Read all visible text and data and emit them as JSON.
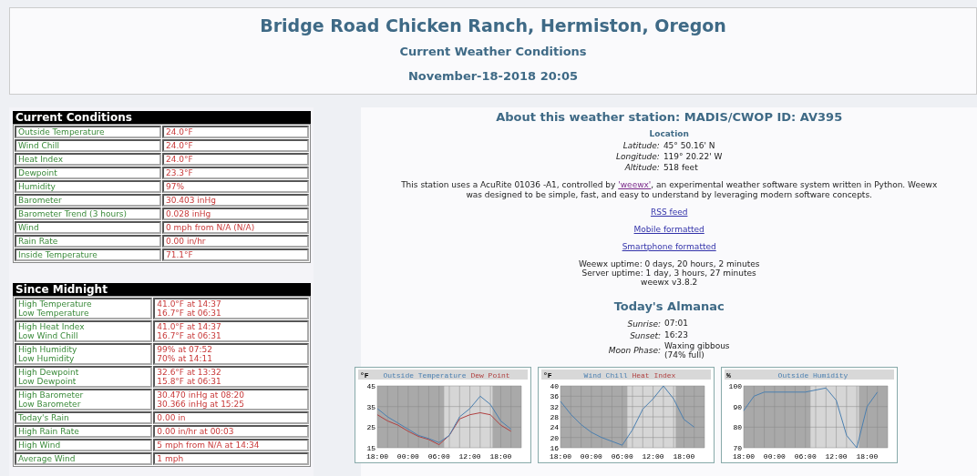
{
  "header": {
    "title": "Bridge Road Chicken Ranch, Hermiston, Oregon",
    "subtitle": "Current Weather Conditions",
    "date": "November-18-2018 20:05"
  },
  "current_conditions": {
    "title": "Current Conditions",
    "rows": [
      {
        "labels": [
          "Outside Temperature"
        ],
        "values": [
          "24.0°F"
        ]
      },
      {
        "labels": [
          "Wind Chill"
        ],
        "values": [
          "24.0°F"
        ]
      },
      {
        "labels": [
          "Heat Index"
        ],
        "values": [
          "24.0°F"
        ]
      },
      {
        "labels": [
          "Dewpoint"
        ],
        "values": [
          "23.3°F"
        ]
      },
      {
        "labels": [
          "Humidity"
        ],
        "values": [
          "97%"
        ]
      },
      {
        "labels": [
          "Barometer"
        ],
        "values": [
          "30.403 inHg"
        ]
      },
      {
        "labels": [
          "Barometer Trend (3 hours)"
        ],
        "values": [
          "0.028 inHg"
        ]
      },
      {
        "labels": [
          "Wind"
        ],
        "values": [
          "0 mph from N/A (N/A)"
        ]
      },
      {
        "labels": [
          "Rain Rate"
        ],
        "values": [
          "0.00 in/hr"
        ]
      },
      {
        "labels": [
          "Inside Temperature"
        ],
        "values": [
          "71.1°F"
        ]
      }
    ]
  },
  "since_midnight": {
    "title": "Since Midnight",
    "rows": [
      {
        "labels": [
          "High Temperature",
          "Low Temperature"
        ],
        "values": [
          "41.0°F at 14:37",
          "16.7°F at 06:31"
        ]
      },
      {
        "labels": [
          "High Heat Index",
          "Low Wind Chill"
        ],
        "values": [
          "41.0°F at 14:37",
          "16.7°F at 06:31"
        ]
      },
      {
        "labels": [
          "High Humidity",
          "Low Humidity"
        ],
        "values": [
          "99% at 07:52",
          "70% at 14:11"
        ]
      },
      {
        "labels": [
          "High Dewpoint",
          "Low Dewpoint"
        ],
        "values": [
          "32.6°F at 13:32",
          "15.8°F at 06:31"
        ]
      },
      {
        "labels": [
          "High Barometer",
          "Low Barometer"
        ],
        "values": [
          "30.470 inHg at 08:20",
          "30.366 inHg at 15:25"
        ]
      },
      {
        "labels": [
          "Today's Rain"
        ],
        "values": [
          "0.00 in"
        ]
      },
      {
        "labels": [
          "High Rain Rate"
        ],
        "values": [
          "0.00 in/hr at 00:03"
        ]
      },
      {
        "labels": [
          "High Wind"
        ],
        "values": [
          "5 mph from N/A at 14:34"
        ]
      },
      {
        "labels": [
          "Average Wind"
        ],
        "values": [
          "1 mph"
        ]
      }
    ]
  },
  "about": {
    "title": "About this weather station: MADIS/CWOP ID: AV395",
    "location_heading": "Location",
    "location": [
      {
        "label": "Latitude:",
        "value": "45° 50.16' N"
      },
      {
        "label": "Longitude:",
        "value": "119° 20.22' W"
      },
      {
        "label": "Altitude:",
        "value": "518 feet"
      }
    ],
    "description_before": "This station uses a AcuRite 01036 -A1, controlled by",
    "description_link": "'weewx'",
    "description_after": ", an experimental weather software system written in Python. Weewx was designed to be simple, fast, and easy to understand by leveraging modern software concepts.",
    "links": [
      "RSS feed",
      "Mobile formatted",
      "Smartphone formatted"
    ],
    "uptime": [
      "Weewx uptime: 0 days, 20 hours, 2 minutes",
      "Server uptime: 1 day, 3 hours, 27 minutes",
      "weewx v3.8.2"
    ]
  },
  "almanac": {
    "title": "Today's Almanac",
    "rows": [
      {
        "label": "Sunrise:",
        "values": [
          "07:01"
        ]
      },
      {
        "label": "Sunset:",
        "values": [
          "16:23"
        ]
      },
      {
        "label": "Moon Phase:",
        "values": [
          "Waxing gibbous",
          "(74% full)"
        ]
      }
    ]
  },
  "charts": [
    {
      "chart_data": {
        "type": "line",
        "ylabel": "°F",
        "grid": true,
        "categories": [
          "18:00",
          null,
          null,
          "00:00",
          null,
          null,
          "06:00",
          null,
          null,
          "12:00",
          null,
          null,
          "18:00",
          null,
          null
        ],
        "ylim": [
          15,
          45
        ],
        "yticks": [
          15,
          25,
          35,
          45
        ],
        "series": [
          {
            "name": "Outside Temperature",
            "color": "#4a7fb0",
            "values": [
              34,
              30,
              27,
              24,
              21,
              19.5,
              17.5,
              21,
              30,
              34,
              40,
              36,
              28,
              24,
              null
            ]
          },
          {
            "name": "Dew Point",
            "color": "#b04040",
            "values": [
              31,
              28,
              26,
              23,
              20.5,
              19,
              16.5,
              21,
              29,
              31,
              32,
              31,
              26,
              23,
              null
            ]
          }
        ]
      }
    },
    {
      "chart_data": {
        "type": "line",
        "ylabel": "°F",
        "grid": true,
        "categories": [
          "18:00",
          null,
          null,
          "00:00",
          null,
          null,
          "06:00",
          null,
          null,
          "12:00",
          null,
          null,
          "18:00",
          null,
          null
        ],
        "ylim": [
          16,
          40
        ],
        "yticks": [
          16,
          20,
          24,
          28,
          32,
          36,
          40
        ],
        "series": [
          {
            "name": "Wind Chill",
            "color": "#4a7fb0",
            "values": [
              34,
              29,
              25,
              22,
              20,
              18.5,
              17,
              23,
              31,
              35,
              40,
              35,
              27,
              24,
              null
            ]
          },
          {
            "name": "Heat Index",
            "color": "#b04040",
            "values": [
              null,
              null,
              null,
              null,
              null,
              null,
              null,
              null,
              null,
              null,
              null,
              null,
              null,
              null,
              null
            ]
          }
        ]
      }
    },
    {
      "chart_data": {
        "type": "line",
        "ylabel": "%",
        "grid": true,
        "categories": [
          "18:00",
          null,
          null,
          "00:00",
          null,
          null,
          "06:00",
          null,
          null,
          "12:00",
          null,
          null,
          "18:00",
          null,
          null
        ],
        "ylim": [
          70,
          100
        ],
        "yticks": [
          70,
          80,
          90,
          100
        ],
        "series": [
          {
            "name": "Outside Humidity",
            "color": "#4a7fb0",
            "values": [
              88,
              95,
              97,
              97,
              97,
              97,
              97,
              98,
              99,
              93,
              76,
              70,
              90,
              97,
              null
            ]
          }
        ]
      }
    }
  ]
}
